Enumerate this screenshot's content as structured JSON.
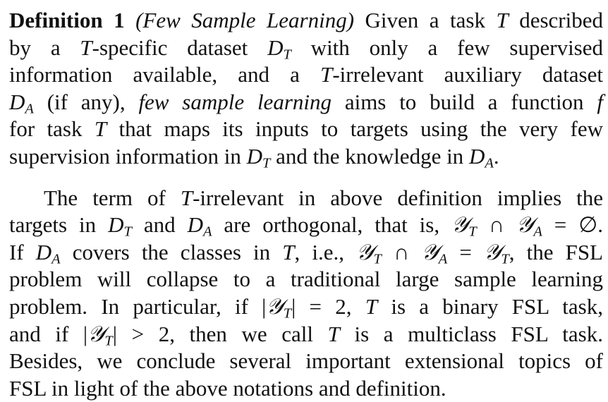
{
  "definition": {
    "label": "Definition 1",
    "title": "(Few Sample Learning)",
    "lines": [
      [
        {
          "t": "Definition 1",
          "s": "bold"
        },
        {
          "t": " "
        },
        {
          "t": "(Few Sample Learning)",
          "s": "ital"
        },
        {
          "t": " Given a task "
        },
        {
          "t": "T",
          "s": "ital"
        },
        {
          "t": " described"
        }
      ],
      [
        {
          "t": "by a "
        },
        {
          "t": "T",
          "s": "ital"
        },
        {
          "t": "-specific dataset "
        },
        {
          "t": "D",
          "s": "ital"
        },
        {
          "t": "T",
          "s": "ital sub"
        },
        {
          "t": " with only a few supervised"
        }
      ],
      [
        {
          "t": "information available, and a "
        },
        {
          "t": "T",
          "s": "ital"
        },
        {
          "t": "-irrelevant auxiliary dataset"
        }
      ],
      [
        {
          "t": "D",
          "s": "ital"
        },
        {
          "t": "A",
          "s": "ital sub"
        },
        {
          "t": " (if any), "
        },
        {
          "t": "few sample learning",
          "s": "ital"
        },
        {
          "t": " aims to build a function "
        },
        {
          "t": "f",
          "s": "ital"
        }
      ],
      [
        {
          "t": "for task "
        },
        {
          "t": "T",
          "s": "ital"
        },
        {
          "t": " that maps its inputs to targets using the very few"
        }
      ],
      [
        {
          "t": "supervision information in "
        },
        {
          "t": "D",
          "s": "ital"
        },
        {
          "t": "T",
          "s": "ital sub"
        },
        {
          "t": " and the knowledge in "
        },
        {
          "t": "D",
          "s": "ital"
        },
        {
          "t": "A",
          "s": "ital sub"
        },
        {
          "t": "."
        }
      ]
    ]
  },
  "paragraph": {
    "lines": [
      [
        {
          "t": "The term of "
        },
        {
          "t": "T",
          "s": "ital"
        },
        {
          "t": "-irrelevant in above definition implies the"
        }
      ],
      [
        {
          "t": "targets in "
        },
        {
          "t": "D",
          "s": "ital"
        },
        {
          "t": "T",
          "s": "ital sub"
        },
        {
          "t": " and "
        },
        {
          "t": "D",
          "s": "ital"
        },
        {
          "t": "A",
          "s": "ital sub"
        },
        {
          "t": " are orthogonal, that is, "
        },
        {
          "t": "𝒴",
          "s": "ital"
        },
        {
          "t": "T",
          "s": "ital sub"
        },
        {
          "t": " ∩ "
        },
        {
          "t": "𝒴",
          "s": "ital"
        },
        {
          "t": "A",
          "s": "ital sub"
        },
        {
          "t": " = ∅."
        }
      ],
      [
        {
          "t": "If "
        },
        {
          "t": "D",
          "s": "ital"
        },
        {
          "t": "A",
          "s": "ital sub"
        },
        {
          "t": " covers the classes in "
        },
        {
          "t": "T",
          "s": "ital"
        },
        {
          "t": ", i.e., "
        },
        {
          "t": "𝒴",
          "s": "ital"
        },
        {
          "t": "T",
          "s": "ital sub"
        },
        {
          "t": " ∩ "
        },
        {
          "t": "𝒴",
          "s": "ital"
        },
        {
          "t": "A",
          "s": "ital sub"
        },
        {
          "t": " = "
        },
        {
          "t": "𝒴",
          "s": "ital"
        },
        {
          "t": "T",
          "s": "ital sub"
        },
        {
          "t": ", the FSL"
        }
      ],
      [
        {
          "t": "problem will collapse to a traditional large sample learning"
        }
      ],
      [
        {
          "t": "problem. In particular, if |"
        },
        {
          "t": "𝒴",
          "s": "ital"
        },
        {
          "t": "T",
          "s": "ital sub"
        },
        {
          "t": "| = 2, "
        },
        {
          "t": "T",
          "s": "ital"
        },
        {
          "t": " is a binary FSL task,"
        }
      ],
      [
        {
          "t": "and if |"
        },
        {
          "t": "𝒴",
          "s": "ital"
        },
        {
          "t": "T",
          "s": "ital sub"
        },
        {
          "t": "| > 2, then we call "
        },
        {
          "t": "T",
          "s": "ital"
        },
        {
          "t": " is a multiclass FSL task."
        }
      ],
      [
        {
          "t": "Besides, we conclude several important extensional topics of"
        }
      ],
      [
        {
          "t": "FSL in light of the above notations and definition."
        }
      ]
    ]
  }
}
